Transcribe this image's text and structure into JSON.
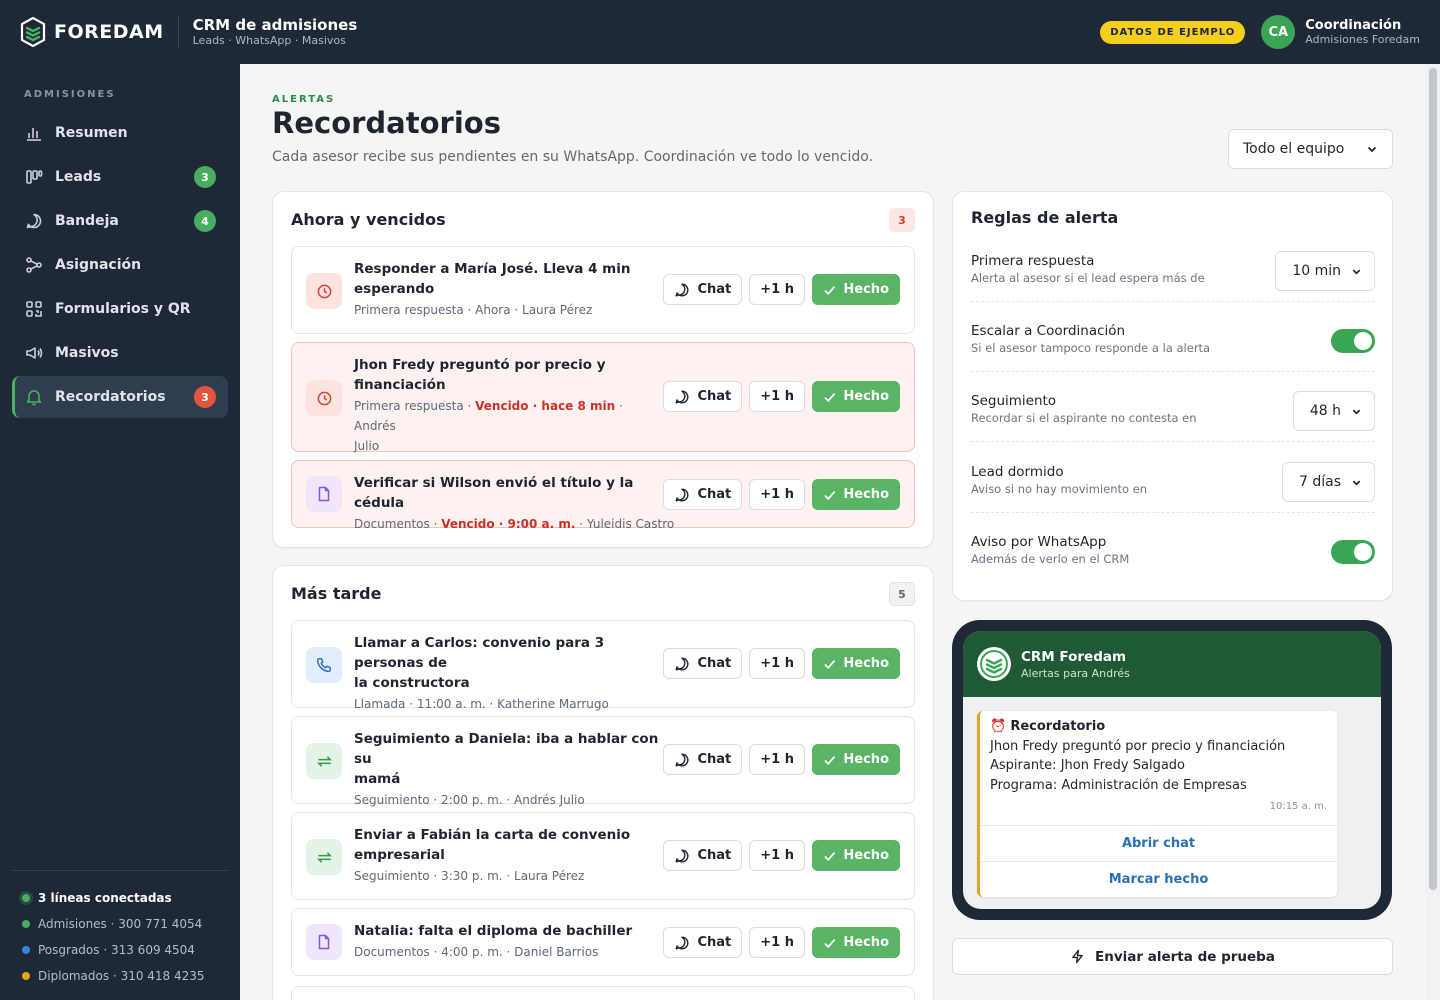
{
  "header": {
    "logo_text": "FOREDAM",
    "app_title": "CRM de admisiones",
    "app_subtitle": "Leads · WhatsApp · Masivos",
    "demo_badge": "DATOS DE EJEMPLO",
    "avatar_initials": "CA",
    "user_name": "Coordinación",
    "user_role": "Admisiones Foredam"
  },
  "sidebar": {
    "section": "ADMISIONES",
    "items": [
      {
        "label": "Resumen",
        "icon": "bar-chart-icon",
        "badge": ""
      },
      {
        "label": "Leads",
        "icon": "kanban-icon",
        "badge": "3"
      },
      {
        "label": "Bandeja",
        "icon": "chat-bubble-icon",
        "badge": "4"
      },
      {
        "label": "Asignación",
        "icon": "share-nodes-icon",
        "badge": ""
      },
      {
        "label": "Formularios y QR",
        "icon": "qr-code-icon",
        "badge": ""
      },
      {
        "label": "Masivos",
        "icon": "megaphone-icon",
        "badge": ""
      },
      {
        "label": "Recordatorios",
        "icon": "bell-icon",
        "badge": "3"
      }
    ],
    "lines_header": "3 líneas conectadas",
    "lines": [
      {
        "label": "Admisiones · 300 771 4054",
        "color": "#49ad5f"
      },
      {
        "label": "Posgrados · 313 609 4504",
        "color": "#3b82e0"
      },
      {
        "label": "Diplomados · 310 418 4235",
        "color": "#e6a417"
      }
    ]
  },
  "page": {
    "eyebrow": "ALERTAS",
    "title": "Recordatorios",
    "description": "Cada asesor recibe sus pendientes en su WhatsApp. Coordinación ve todo lo vencido.",
    "team_filter": "Todo el equipo"
  },
  "actions": {
    "chat": "Chat",
    "snooze": "+1 h",
    "done": "Hecho"
  },
  "now_card": {
    "title": "Ahora y vencidos",
    "count": "3",
    "items": [
      {
        "title_l1": "Responder a María José. Lleva 4 min",
        "title_l2": "esperando",
        "meta_pre": "Primera respuesta · Ahora · Laura Pérez",
        "late": "",
        "meta_post": "",
        "meta_post2": ""
      },
      {
        "title_l1": "Jhon Fredy preguntó por precio y",
        "title_l2": "financiación",
        "meta_pre": "Primera respuesta · ",
        "late": "Vencido · hace 8 min",
        "meta_post": " · Andrés",
        "meta_post2": "Julio"
      },
      {
        "title_l1": "Verificar si Wilson envió el título y la cédula",
        "title_l2": "",
        "meta_pre": "Documentos · ",
        "late": "Vencido · 9:00 a. m.",
        "meta_post": " · Yuleidis Castro",
        "meta_post2": ""
      }
    ]
  },
  "later_card": {
    "title": "Más tarde",
    "count": "5",
    "items": [
      {
        "title_l1": "Llamar a Carlos: convenio para 3 personas de",
        "title_l2": "la constructora",
        "meta": "Llamada · 11:00 a. m. · Katherine Marrugo"
      },
      {
        "title_l1": "Seguimiento a Daniela: iba a hablar con su",
        "title_l2": "mamá",
        "meta": "Seguimiento · 2:00 p. m. · Andrés Julio"
      },
      {
        "title_l1": "Enviar a Fabián la carta de convenio",
        "title_l2": "empresarial",
        "meta": "Seguimiento · 3:30 p. m. · Laura Pérez"
      },
      {
        "title_l1": "Natalia: falta el diploma de bachiller",
        "title_l2": "",
        "meta": "Documentos · 4:00 p. m. · Daniel Barrios"
      }
    ]
  },
  "rules": {
    "title": "Reglas de alerta",
    "items": [
      {
        "title": "Primera respuesta",
        "sub": "Alerta al asesor si el lead espera más de",
        "value": "10 min"
      },
      {
        "title": "Escalar a Coordinación",
        "sub": "Si el asesor tampoco responde a la alerta",
        "toggle": true
      },
      {
        "title": "Seguimiento",
        "sub": "Recordar si el aspirante no contesta en",
        "value": "48 h"
      },
      {
        "title": "Lead dormido",
        "sub": "Aviso si no hay movimiento en",
        "value": "7 días"
      },
      {
        "title": "Aviso por WhatsApp",
        "sub": "Además de verlo en el CRM",
        "toggle": true
      }
    ]
  },
  "preview": {
    "chat_name": "CRM Foredam",
    "chat_sub": "Alertas para Andrés",
    "msg_title": "Recordatorio",
    "msg_line1": "Jhon Fredy preguntó por precio y financiación",
    "msg_line2": "Aspirante: Jhon Fredy Salgado",
    "msg_line3": "Programa: Administración de Empresas",
    "msg_time": "10:15 a. m.",
    "btn_open": "Abrir chat",
    "btn_done": "Marcar hecho",
    "test_button": "Enviar alerta de prueba"
  },
  "colors": {
    "accent": "#3aa655",
    "sidebar_bg": "#1e2836",
    "danger": "#c9322a",
    "demo": "#f4cf1c"
  }
}
